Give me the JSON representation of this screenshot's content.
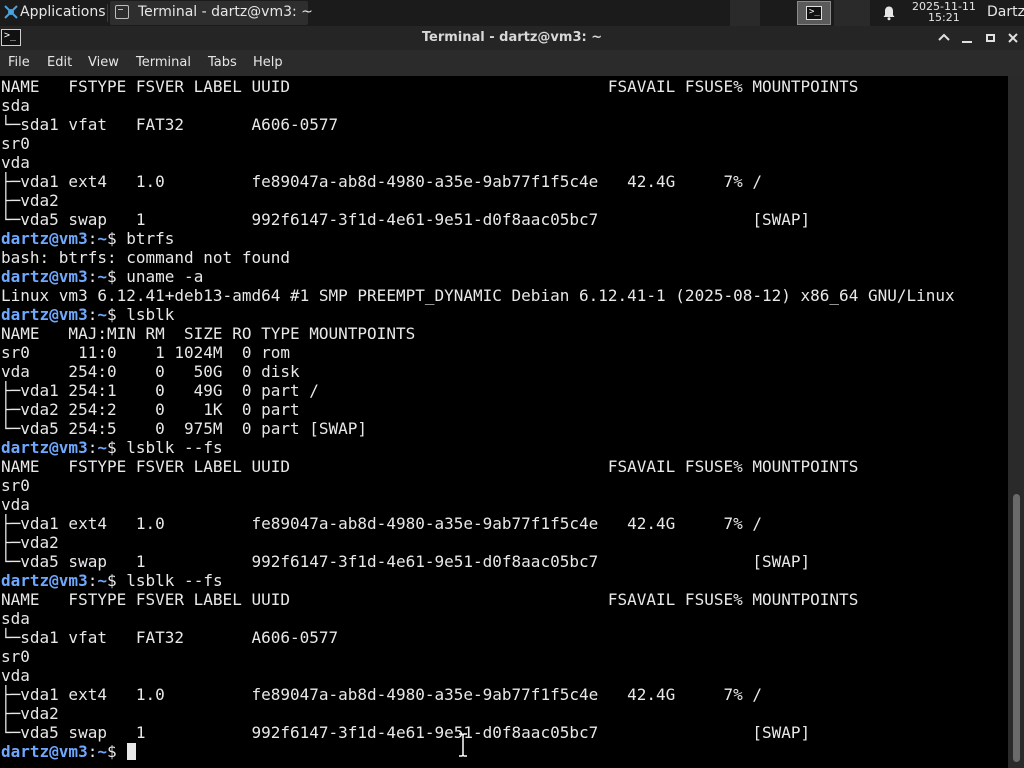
{
  "panel": {
    "applications_label": "Applications",
    "task_label": "Terminal - dartz@vm3: ~",
    "clock_date": "2025-11-11",
    "clock_time": "15:21",
    "user": "Dartz"
  },
  "window": {
    "title": "Terminal - dartz@vm3: ~"
  },
  "menu": {
    "file": "File",
    "edit": "Edit",
    "view": "View",
    "terminal": "Terminal",
    "tabs": "Tabs",
    "help": "Help"
  },
  "terminal": {
    "lines": [
      {
        "kind": "out",
        "text": "NAME   FSTYPE FSVER LABEL UUID                                 FSAVAIL FSUSE% MOUNTPOINTS"
      },
      {
        "kind": "out",
        "text": "sda"
      },
      {
        "kind": "out",
        "text": "└─sda1 vfat   FAT32       A606-0577"
      },
      {
        "kind": "out",
        "text": "sr0"
      },
      {
        "kind": "out",
        "text": "vda"
      },
      {
        "kind": "out",
        "text": "├─vda1 ext4   1.0         fe89047a-ab8d-4980-a35e-9ab77f1f5c4e   42.4G     7% /"
      },
      {
        "kind": "out",
        "text": "├─vda2"
      },
      {
        "kind": "out",
        "text": "└─vda5 swap   1           992f6147-3f1d-4e61-9e51-d0f8aac05bc7                [SWAP]"
      },
      {
        "kind": "cmd",
        "user": "dartz@vm3",
        "path": "~",
        "cmd": " btrfs"
      },
      {
        "kind": "out",
        "text": "bash: btrfs: command not found"
      },
      {
        "kind": "cmd",
        "user": "dartz@vm3",
        "path": "~",
        "cmd": " uname -a"
      },
      {
        "kind": "out",
        "text": "Linux vm3 6.12.41+deb13-amd64 #1 SMP PREEMPT_DYNAMIC Debian 6.12.41-1 (2025-08-12) x86_64 GNU/Linux"
      },
      {
        "kind": "cmd",
        "user": "dartz@vm3",
        "path": "~",
        "cmd": " lsblk"
      },
      {
        "kind": "out",
        "text": "NAME   MAJ:MIN RM  SIZE RO TYPE MOUNTPOINTS"
      },
      {
        "kind": "out",
        "text": "sr0     11:0    1 1024M  0 rom"
      },
      {
        "kind": "out",
        "text": "vda    254:0    0   50G  0 disk"
      },
      {
        "kind": "out",
        "text": "├─vda1 254:1    0   49G  0 part /"
      },
      {
        "kind": "out",
        "text": "├─vda2 254:2    0    1K  0 part"
      },
      {
        "kind": "out",
        "text": "└─vda5 254:5    0  975M  0 part [SWAP]"
      },
      {
        "kind": "cmd",
        "user": "dartz@vm3",
        "path": "~",
        "cmd": " lsblk --fs"
      },
      {
        "kind": "out",
        "text": "NAME   FSTYPE FSVER LABEL UUID                                 FSAVAIL FSUSE% MOUNTPOINTS"
      },
      {
        "kind": "out",
        "text": "sr0"
      },
      {
        "kind": "out",
        "text": "vda"
      },
      {
        "kind": "out",
        "text": "├─vda1 ext4   1.0         fe89047a-ab8d-4980-a35e-9ab77f1f5c4e   42.4G     7% /"
      },
      {
        "kind": "out",
        "text": "├─vda2"
      },
      {
        "kind": "out",
        "text": "└─vda5 swap   1           992f6147-3f1d-4e61-9e51-d0f8aac05bc7                [SWAP]"
      },
      {
        "kind": "cmd",
        "user": "dartz@vm3",
        "path": "~",
        "cmd": " lsblk --fs"
      },
      {
        "kind": "out",
        "text": "NAME   FSTYPE FSVER LABEL UUID                                 FSAVAIL FSUSE% MOUNTPOINTS"
      },
      {
        "kind": "out",
        "text": "sda"
      },
      {
        "kind": "out",
        "text": "└─sda1 vfat   FAT32       A606-0577"
      },
      {
        "kind": "out",
        "text": "sr0"
      },
      {
        "kind": "out",
        "text": "vda"
      },
      {
        "kind": "out",
        "text": "├─vda1 ext4   1.0         fe89047a-ab8d-4980-a35e-9ab77f1f5c4e   42.4G     7% /"
      },
      {
        "kind": "out",
        "text": "├─vda2"
      },
      {
        "kind": "out",
        "text": "└─vda5 swap   1           992f6147-3f1d-4e61-9e51-d0f8aac05bc7                [SWAP]"
      },
      {
        "kind": "prompt",
        "user": "dartz@vm3",
        "path": "~",
        "cmd": " "
      }
    ]
  }
}
